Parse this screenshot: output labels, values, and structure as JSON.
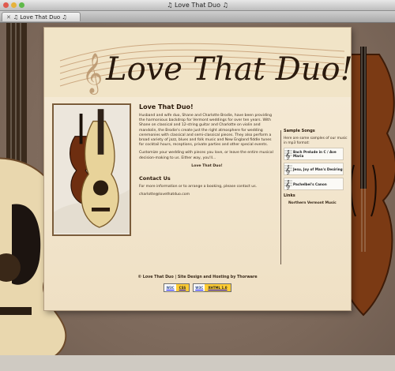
{
  "window": {
    "title": "♫ Love That Duo ♫",
    "tab_label": "♫ Love That Duo ♫"
  },
  "banner": {
    "title": "Love That Duo!"
  },
  "main": {
    "heading": "Love That Duo!",
    "paragraph1": "Husband and wife duo, Shane and Charlotte Brodie, have been providing the harmonious backdrop for Vermont weddings for over ten years. With Shane on classical and 12-string guitar and Charlotte on violin and mandolin, the Brodie's create just the right atmosphere for wedding ceremonies with classical and semi-classical pieces. They also perform a broad variety of jazz, blues and folk music and New England fiddle tunes for cocktail hours, receptions, private parties and other special events.",
    "paragraph2": "Customize your wedding with pieces you love, or leave the entire musical decision-making to us. Either way, you'll...",
    "tagline": "Love That Duo!",
    "contact_heading": "Contact Us",
    "contact_text": "For more information or to arrange a booking, please contact us.",
    "email": "charlotte@lovethatduo.com"
  },
  "sidebar": {
    "samples_heading": "Sample Songs",
    "samples_intro": "Here are some samples of our music in mp3 format:",
    "songs": [
      {
        "title": "Bach Prelude in C / Ave Maria"
      },
      {
        "title": "Jesu, Joy of Man's Desiring"
      },
      {
        "title": "Pachelbel's Canon"
      }
    ],
    "links_heading": "Links",
    "link": "Northern Vermont Music"
  },
  "footer": {
    "text": "© Love That Duo | Site Design and Hosting by Thorware",
    "badge1": {
      "left": "W3C",
      "right": "CSS"
    },
    "badge2": {
      "left": "W3C",
      "right": "XHTML 1.0"
    }
  },
  "colors": {
    "background": "#8a7668",
    "paper": "#f3e6cd",
    "text": "#3a2a1a",
    "frame": "#7a5c3a"
  }
}
